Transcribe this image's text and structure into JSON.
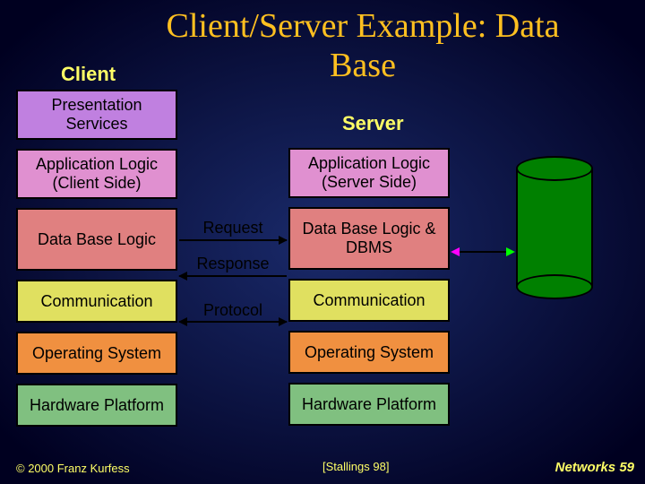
{
  "title": "Client/Server Example: Data Base",
  "headings": {
    "client": "Client",
    "server": "Server"
  },
  "client_stack": {
    "presentation": "Presentation Services",
    "app_logic": "Application Logic (Client Side)",
    "db_logic": "Data Base Logic",
    "comm": "Communication",
    "os": "Operating System",
    "hw": "Hardware Platform"
  },
  "server_stack": {
    "app_logic": "Application Logic (Server Side)",
    "db_logic": "Data Base Logic & DBMS",
    "comm": "Communication",
    "os": "Operating System",
    "hw": "Hardware Platform"
  },
  "mid": {
    "request": "Request",
    "response": "Response",
    "protocol": "Protocol"
  },
  "footer": {
    "copyright": "© 2000 Franz Kurfess",
    "citation": "[Stallings 98]",
    "page": "Networks  59"
  },
  "colors": {
    "purple": "#c080e0",
    "pink": "#e090d0",
    "salmon": "#e08080",
    "yellow": "#e0e060",
    "orange": "#f09040",
    "green": "#80c080",
    "db": "#008000",
    "accent": "#ffc020",
    "text": "#ffff66"
  }
}
